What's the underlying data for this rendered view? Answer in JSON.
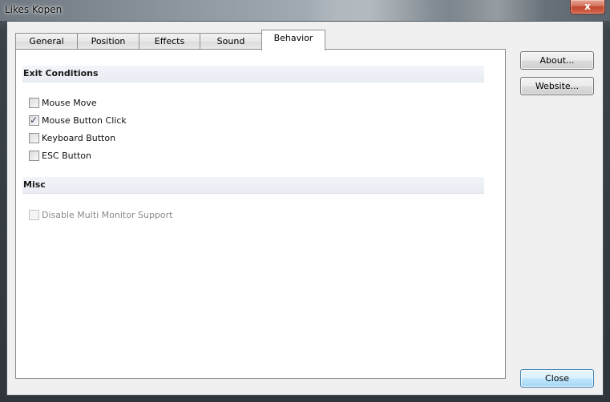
{
  "window": {
    "title": "Likes Kopen",
    "close_glyph": "x"
  },
  "tabs": [
    {
      "label": "General",
      "selected": false
    },
    {
      "label": "Position",
      "selected": false
    },
    {
      "label": "Effects",
      "selected": false
    },
    {
      "label": "Sound",
      "selected": false
    },
    {
      "label": "Behavior",
      "selected": true
    }
  ],
  "panel": {
    "exit_conditions": {
      "title": "Exit Conditions",
      "options": [
        {
          "label": "Mouse Move",
          "checked": false
        },
        {
          "label": "Mouse Button Click",
          "checked": true
        },
        {
          "label": "Keyboard Button",
          "checked": false
        },
        {
          "label": "ESC Button",
          "checked": false
        }
      ]
    },
    "misc": {
      "title": "Misc",
      "options": [
        {
          "label": "Disable Multi Monitor Support",
          "checked": false,
          "enabled": false
        }
      ]
    }
  },
  "buttons": {
    "about": "About...",
    "website": "Website...",
    "close": "Close"
  },
  "icons": {
    "check": "checkmark-icon",
    "close": "close-icon"
  },
  "colors": {
    "selection_accent": "#3c7fb1",
    "close_button": "#c0452d"
  }
}
